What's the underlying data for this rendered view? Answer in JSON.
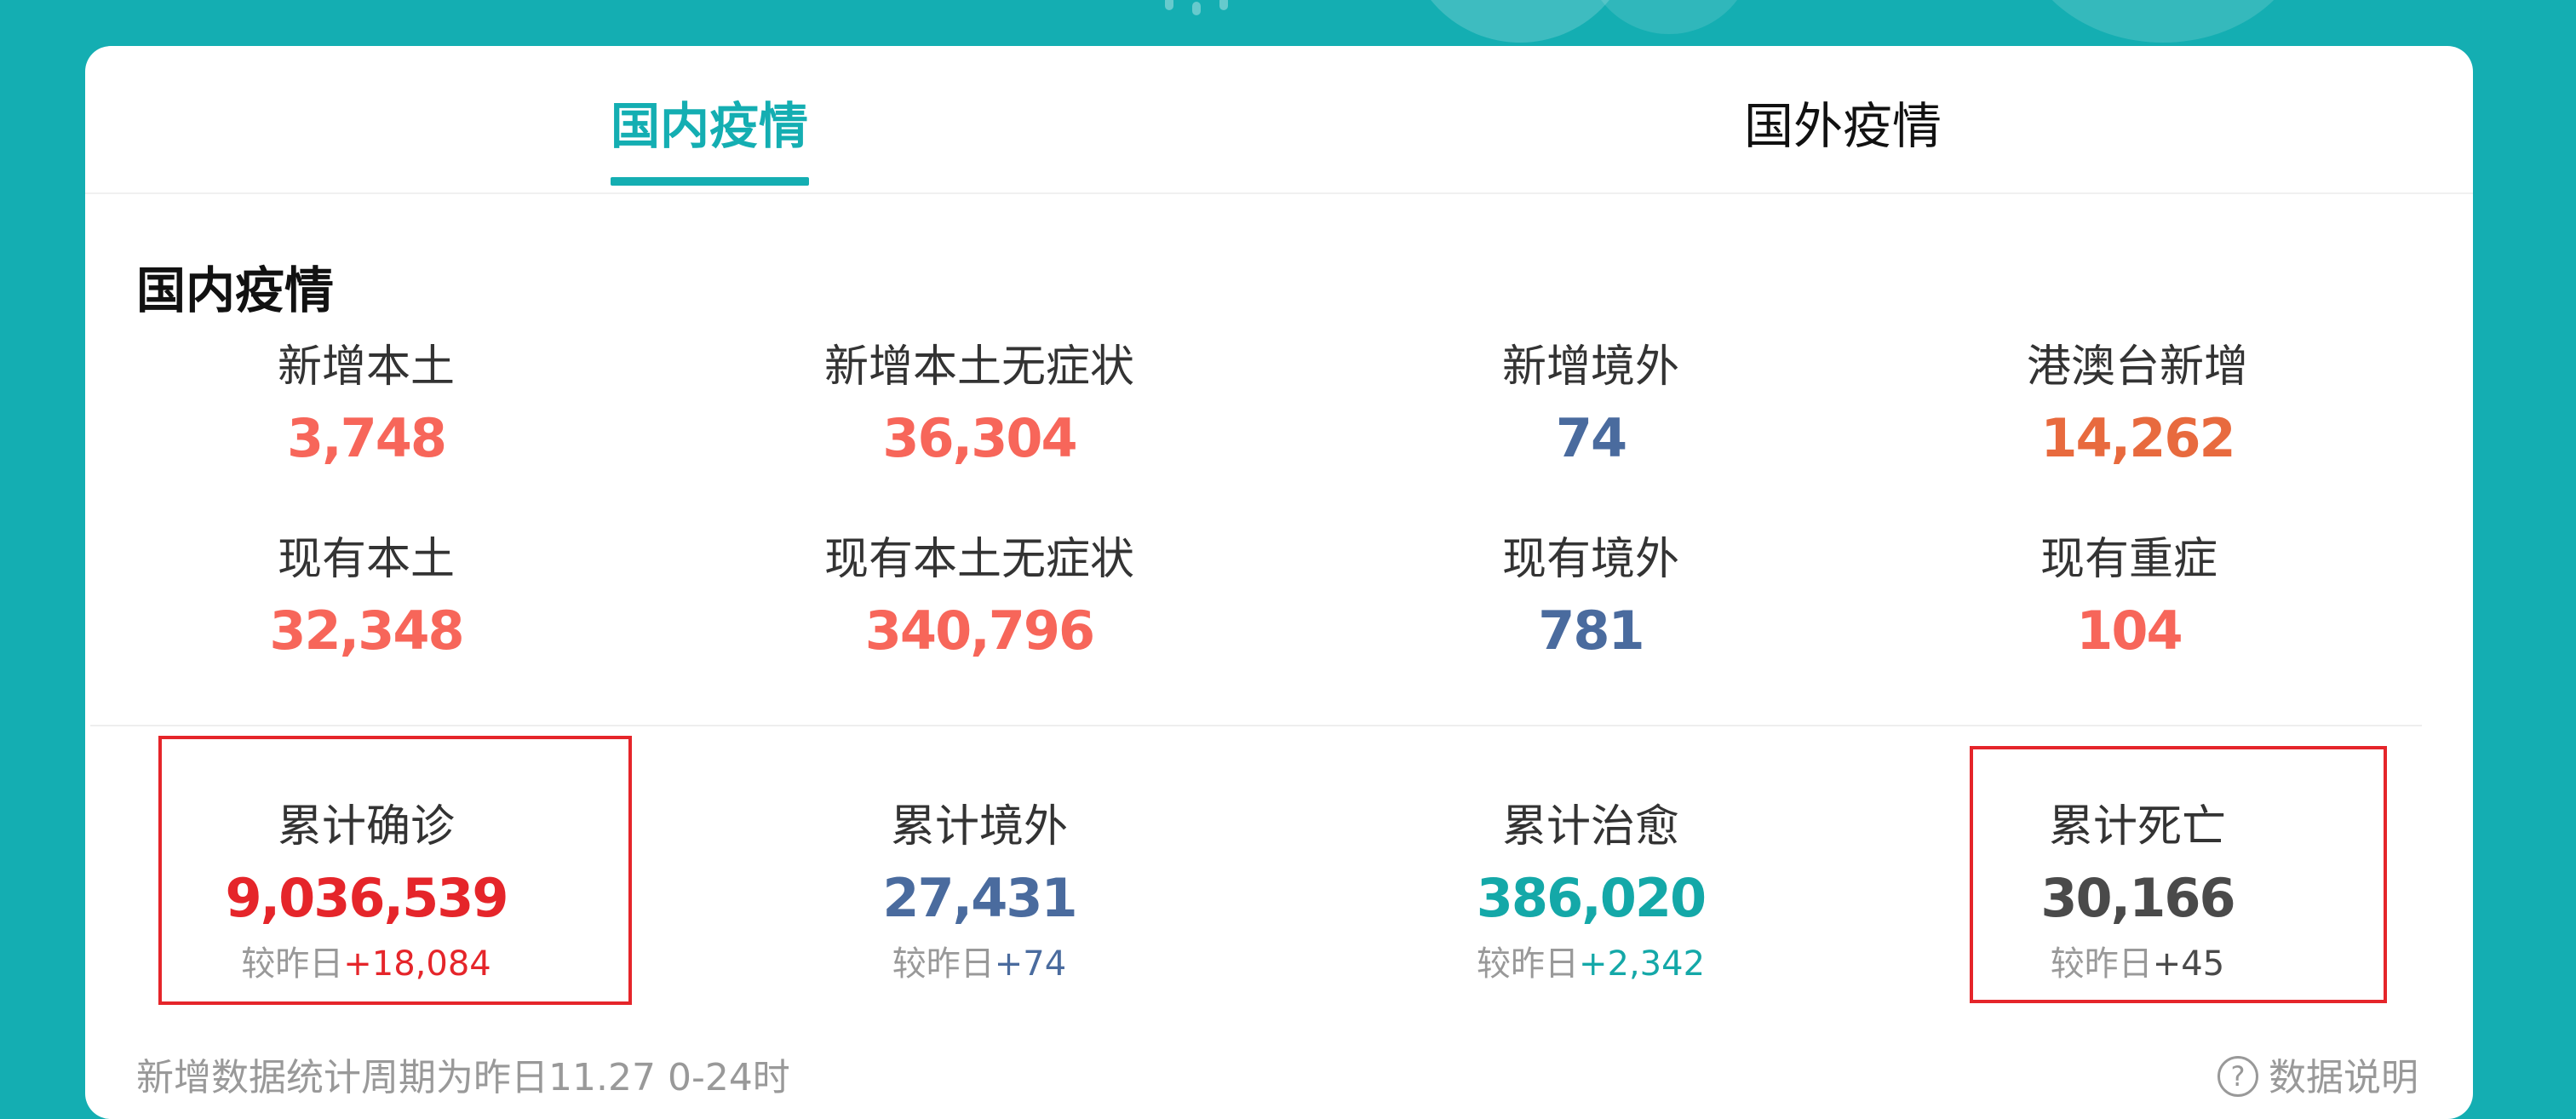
{
  "tabs": {
    "domestic": "国内疫情",
    "overseas": "国外疫情"
  },
  "section": {
    "title": "国内疫情"
  },
  "stats_row1": [
    {
      "label": "新增本土",
      "value": "3,748",
      "color": "#f7665a"
    },
    {
      "label": "新增本土无症状",
      "value": "36,304",
      "color": "#f7665a"
    },
    {
      "label": "新增境外",
      "value": "74",
      "color": "#4a6b9e"
    },
    {
      "label": "港澳台新增",
      "value": "14,262",
      "color": "#e86a3e"
    }
  ],
  "stats_row2": [
    {
      "label": "现有本土",
      "value": "32,348",
      "color": "#f7665a"
    },
    {
      "label": "现有本土无症状",
      "value": "340,796",
      "color": "#f7665a"
    },
    {
      "label": "现有境外",
      "value": "781",
      "color": "#4a6b9e"
    },
    {
      "label": "现有重症",
      "value": "104",
      "color": "#f7665a"
    }
  ],
  "stats_totals": [
    {
      "label": "累计确诊",
      "value": "9,036,539",
      "delta_prefix": "较昨日",
      "delta": "+18,084",
      "color": "#e5252a"
    },
    {
      "label": "累计境外",
      "value": "27,431",
      "delta_prefix": "较昨日",
      "delta": "+74",
      "color": "#4a6b9e"
    },
    {
      "label": "累计治愈",
      "value": "386,020",
      "delta_prefix": "较昨日",
      "delta": "+2,342",
      "color": "#14a8a8"
    },
    {
      "label": "累计死亡",
      "value": "30,166",
      "delta_prefix": "较昨日",
      "delta": "+45",
      "color": "#4a4a4a"
    }
  ],
  "footer": {
    "note": "新增数据统计周期为昨日11.27 0-24时",
    "help_icon": "?",
    "data_explanation": "数据说明"
  },
  "colors": {
    "accent": "#14aeb2",
    "highlight_border": "#e5252a"
  }
}
